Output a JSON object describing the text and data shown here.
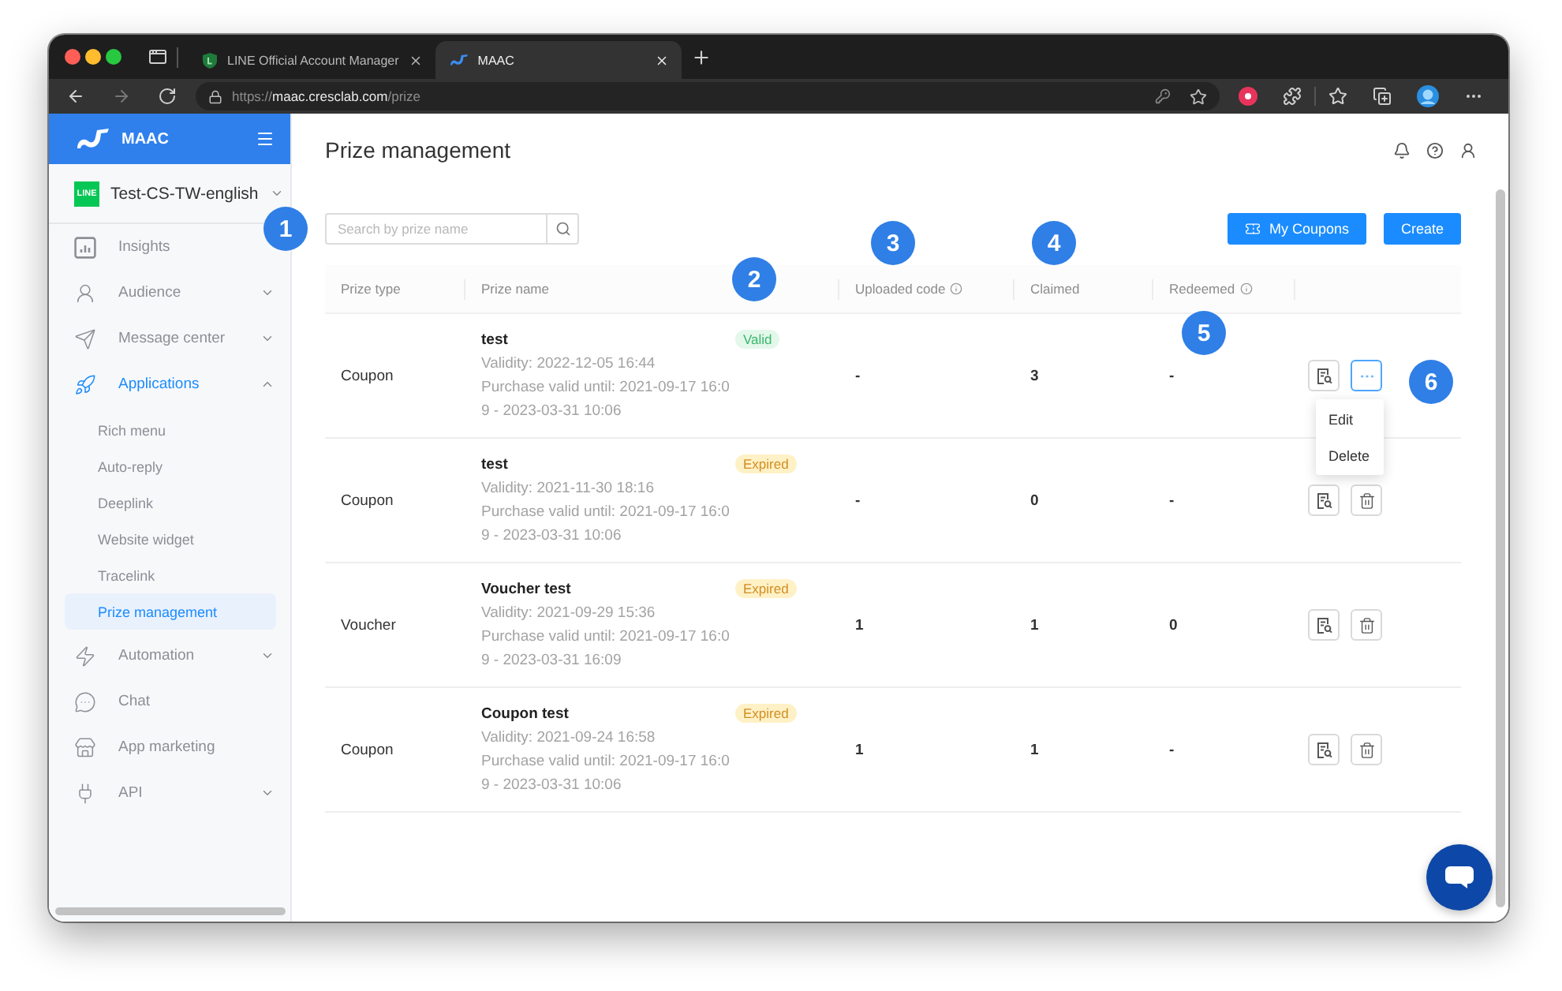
{
  "browser": {
    "tabs": [
      {
        "title": "LINE Official Account Manager",
        "selected": false
      },
      {
        "title": "MAAC",
        "selected": true
      }
    ],
    "address": {
      "scheme": "https://",
      "host": "maac.cresclab.com",
      "path": "/prize"
    }
  },
  "sidebar": {
    "brand": "MAAC",
    "account": {
      "badge": "LINE",
      "name": "Test-CS-TW-english"
    },
    "items": [
      {
        "label": "Insights",
        "kind": "link",
        "selected": false
      },
      {
        "label": "Audience",
        "kind": "group",
        "selected": false,
        "expanded": false
      },
      {
        "label": "Message center",
        "kind": "group",
        "selected": false,
        "expanded": false
      },
      {
        "label": "Applications",
        "kind": "group",
        "selected": true,
        "expanded": true,
        "children": [
          {
            "label": "Rich menu",
            "selected": false
          },
          {
            "label": "Auto-reply",
            "selected": false
          },
          {
            "label": "Deeplink",
            "selected": false
          },
          {
            "label": "Website widget",
            "selected": false
          },
          {
            "label": "Tracelink",
            "selected": false
          },
          {
            "label": "Prize management",
            "selected": true
          }
        ]
      },
      {
        "label": "Automation",
        "kind": "group",
        "selected": false,
        "expanded": false
      },
      {
        "label": "Chat",
        "kind": "link",
        "selected": false
      },
      {
        "label": "App marketing",
        "kind": "link",
        "selected": false
      },
      {
        "label": "API",
        "kind": "group",
        "selected": false,
        "expanded": false
      }
    ]
  },
  "page": {
    "title": "Prize management",
    "search": {
      "placeholder": "Search by prize name"
    },
    "buttons": [
      {
        "label": "My Coupons",
        "has_icon": true
      },
      {
        "label": "Create",
        "has_icon": false
      }
    ]
  },
  "table": {
    "columns": [
      {
        "label": "Prize type",
        "info": false
      },
      {
        "label": "Prize name",
        "info": false
      },
      {
        "label": "Uploaded code",
        "info": true
      },
      {
        "label": "Claimed",
        "info": false
      },
      {
        "label": "Redeemed",
        "info": true
      }
    ],
    "rows": [
      {
        "type": "Coupon",
        "name": "test",
        "status": {
          "label": "Valid",
          "kind": "valid"
        },
        "validity": "Validity: 2022-12-05 16:44",
        "purchase": "Purchase valid until: 2021-09-17 16:09 - 2023-03-31 10:06",
        "uploaded": "-",
        "claimed": "3",
        "redeemed": "-",
        "actions": [
          {
            "kind": "report"
          },
          {
            "kind": "more",
            "open": true,
            "menu": [
              {
                "label": "Edit"
              },
              {
                "label": "Delete"
              }
            ]
          }
        ]
      },
      {
        "type": "Coupon",
        "name": "test",
        "status": {
          "label": "Expired",
          "kind": "expired"
        },
        "validity": "Validity: 2021-11-30 18:16",
        "purchase": "Purchase valid until: 2021-09-17 16:09 - 2023-03-31 10:06",
        "uploaded": "-",
        "claimed": "0",
        "redeemed": "-",
        "actions": [
          {
            "kind": "report"
          },
          {
            "kind": "delete"
          }
        ]
      },
      {
        "type": "Voucher",
        "name": "Voucher test",
        "status": {
          "label": "Expired",
          "kind": "expired"
        },
        "validity": "Validity: 2021-09-29 15:36",
        "purchase": "Purchase valid until: 2021-09-17 16:09 - 2023-03-31 16:09",
        "uploaded": "1",
        "claimed": "1",
        "redeemed": "0",
        "actions": [
          {
            "kind": "report"
          },
          {
            "kind": "delete"
          }
        ]
      },
      {
        "type": "Coupon",
        "name": "Coupon test",
        "status": {
          "label": "Expired",
          "kind": "expired"
        },
        "validity": "Validity: 2021-09-24 16:58",
        "purchase": "Purchase valid until: 2021-09-17 16:09 - 2023-03-31 10:06",
        "uploaded": "1",
        "claimed": "1",
        "redeemed": "-",
        "actions": [
          {
            "kind": "report"
          },
          {
            "kind": "delete"
          }
        ]
      }
    ]
  },
  "annotations": [
    "1",
    "2",
    "3",
    "4",
    "5",
    "6"
  ]
}
